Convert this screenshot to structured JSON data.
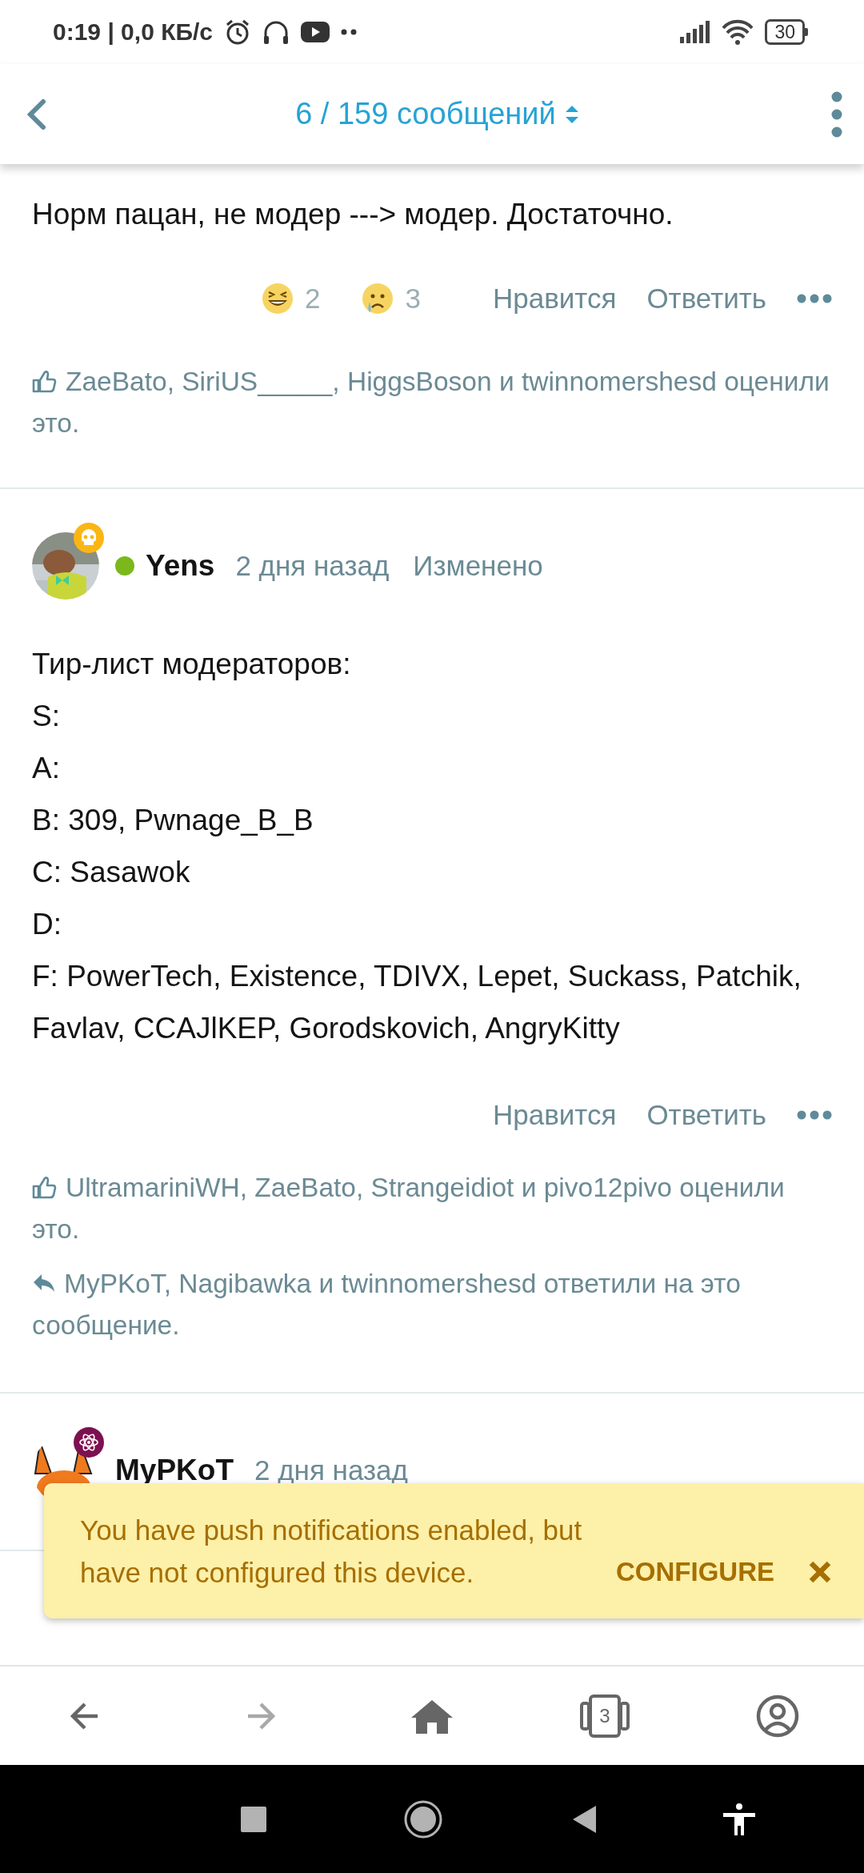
{
  "status_bar": {
    "time_speed": "0:19 | 0,0 КБ/с",
    "battery": "30"
  },
  "header": {
    "title": "6 / 159 сообщений"
  },
  "posts": [
    {
      "body": [
        "Норм пацан, не модер ---> модер. Достаточно."
      ],
      "reactions": [
        {
          "kind": "laugh",
          "count": "2"
        },
        {
          "kind": "cry",
          "count": "3"
        }
      ],
      "actions": [
        "Нравится",
        "Ответить"
      ],
      "liked_by": "ZaeBato, SiriUS_____, HiggsBoson и twinnomershesd оценили это."
    },
    {
      "author": "Yens",
      "online": true,
      "time": "2 дня назад",
      "edited": "Изменено",
      "body": [
        "Тир-лист модераторов:",
        "S:",
        "A:",
        "B: 309, Pwnage_B_B",
        "C: Sasawok",
        "D:",
        "F: PowerTech, Existence, TDIVX, Lepet, Suckass, Patchik, Favlav, CCAJlKEP, Gorodskovich, AngryKitty"
      ],
      "actions": [
        "Нравится",
        "Ответить"
      ],
      "liked_by": "UltramariniWH, ZaeBato, Strangeidiot и pivo12pivo оценили это.",
      "replied_by": "MyPKoT, Nagibawka и twinnomershesd ответили на это сообщение."
    },
    {
      "author": "MyPKoT",
      "time": "2 дня назад"
    }
  ],
  "toast": {
    "message": "You have push notifications enabled, but have not configured this device.",
    "action": "CONFIGURE"
  },
  "bottom_nav": [
    {
      "kind": "back",
      "disabled": false
    },
    {
      "kind": "forward",
      "disabled": true
    },
    {
      "kind": "home",
      "disabled": false
    },
    {
      "kind": "tabs",
      "count": "3",
      "disabled": false
    },
    {
      "kind": "account",
      "disabled": false
    }
  ]
}
